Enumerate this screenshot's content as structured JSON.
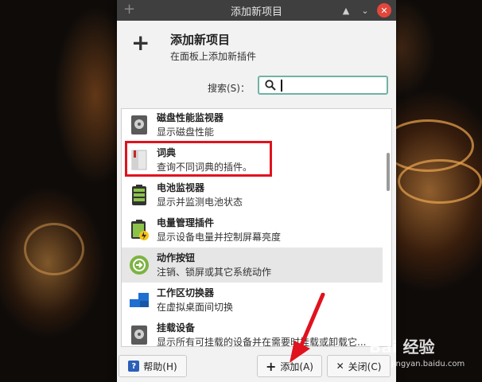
{
  "window": {
    "title": "添加新项目",
    "header_title": "添加新项目",
    "header_subtitle": "在面板上添加新插件"
  },
  "search": {
    "label": "搜索(S)：",
    "value": ""
  },
  "items": [
    {
      "name": "磁盘性能监视器",
      "desc": "显示磁盘性能",
      "icon": "disk-icon"
    },
    {
      "name": "词典",
      "desc": "查询不同词典的插件。",
      "icon": "dictionary-icon"
    },
    {
      "name": "电池监视器",
      "desc": "显示并监测电池状态",
      "icon": "battery-icon"
    },
    {
      "name": "电量管理插件",
      "desc": "显示设备电量并控制屏幕亮度",
      "icon": "power-manager-icon"
    },
    {
      "name": "动作按钮",
      "desc": "注销、锁屏或其它系统动作",
      "icon": "action-buttons-icon"
    },
    {
      "name": "工作区切换器",
      "desc": "在虚拟桌面间切换",
      "icon": "workspace-switcher-icon"
    },
    {
      "name": "挂载设备",
      "desc": "显示所有可挂载的设备并在需要时挂载或卸载它...",
      "icon": "mount-icon"
    }
  ],
  "buttons": {
    "help": "帮助(H)",
    "add": "添加(A)",
    "close": "关闭(C)"
  },
  "watermark": {
    "text": "Bai 经验",
    "url": "jingyan.baidu.com"
  },
  "colors": {
    "highlight_box": "#e0121d",
    "search_focus": "#6fb3a5",
    "titlebar": "#3f3f3f",
    "close_button": "#e1473b"
  }
}
